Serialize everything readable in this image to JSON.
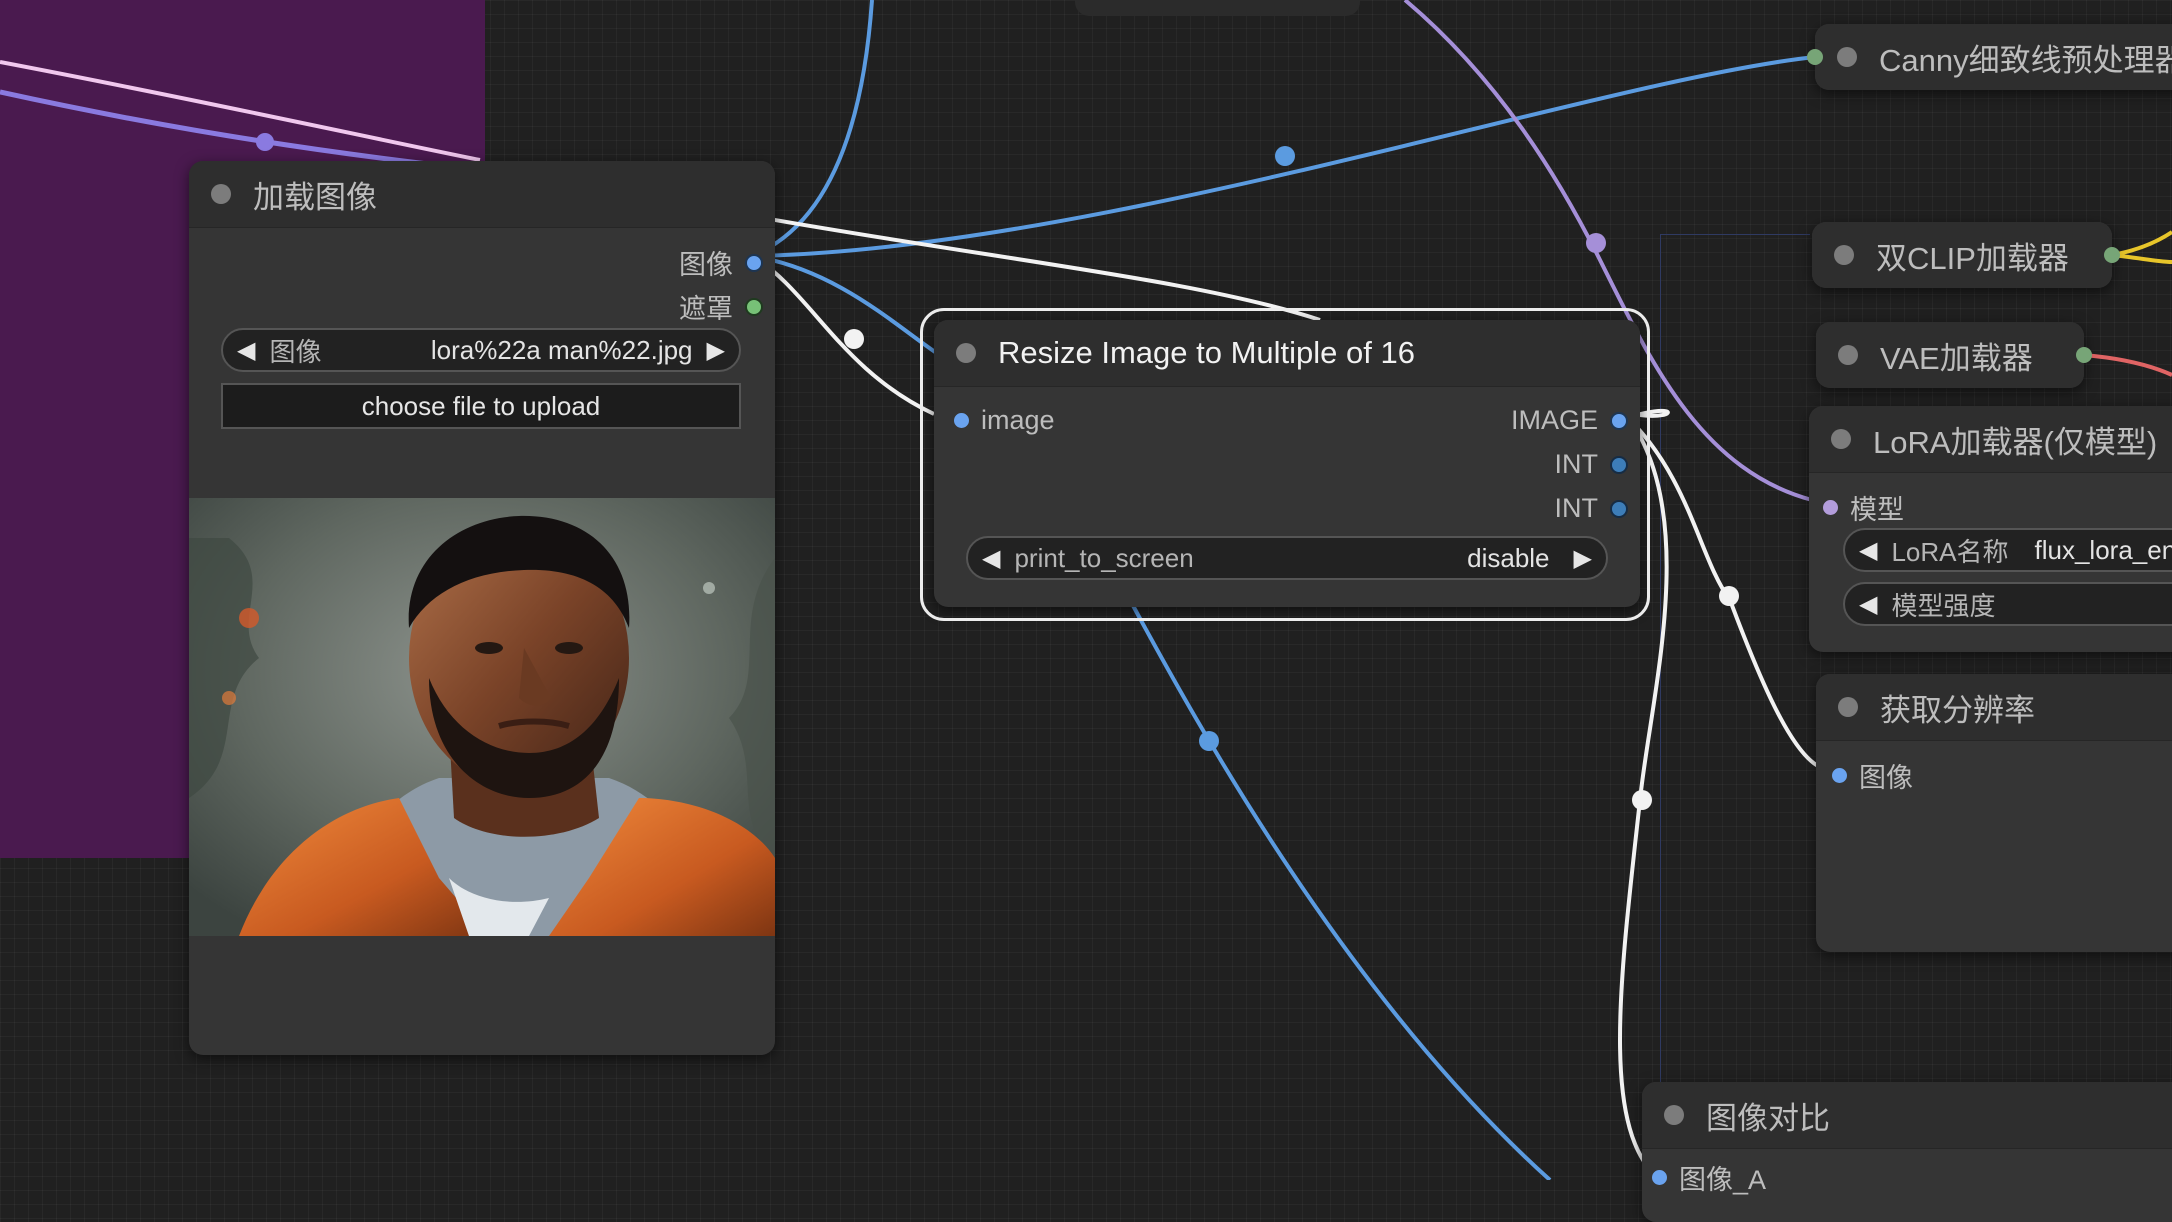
{
  "load_image_node": {
    "title": "加载图像",
    "outputs": [
      {
        "label": "图像",
        "color": "#6aa3ef"
      },
      {
        "label": "遮罩",
        "color": "#77c177"
      }
    ],
    "image_widget": {
      "label": "图像",
      "value": "lora%22a man%22.jpg"
    },
    "upload_label": "choose file to upload"
  },
  "resize_node": {
    "title": "Resize Image to Multiple of 16",
    "input": {
      "label": "image",
      "color": "#6aa3ef"
    },
    "outputs": [
      {
        "label": "IMAGE",
        "color": "#6aa3ef"
      },
      {
        "label": "INT",
        "color": "#3d7db8"
      },
      {
        "label": "INT",
        "color": "#3d7db8"
      }
    ],
    "print_widget": {
      "label": "print_to_screen",
      "value": "disable"
    }
  },
  "canny_node": {
    "title": "Canny细致线预处理器"
  },
  "dual_clip_node": {
    "title": "双CLIP加载器"
  },
  "vae_node": {
    "title": "VAE加载器"
  },
  "lora_node": {
    "title": "LoRA加载器(仅模型)",
    "input": {
      "label": "模型",
      "color": "#b39ddb"
    },
    "name_widget": {
      "label": "LoRA名称",
      "value": "flux_lora_en"
    },
    "strength_widget": {
      "label": "模型强度"
    }
  },
  "resolution_node": {
    "title": "获取分辨率",
    "input": {
      "label": "图像",
      "color": "#6aa3ef"
    }
  },
  "compare_node": {
    "title": "图像对比",
    "input": {
      "label": "图像_A"
    }
  },
  "colors": {
    "image_link": "#5b9be0",
    "model_link": "#a58fd8",
    "clip_link": "#e7c52a",
    "vae_link": "#e06464",
    "white_link": "#f2f2f2",
    "group": "#4a1a4f"
  }
}
